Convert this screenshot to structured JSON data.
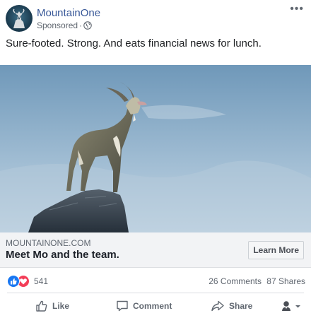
{
  "header": {
    "page_name": "MountainOne",
    "sponsored": "Sponsored",
    "separator": "·",
    "more_label": "•••"
  },
  "post": {
    "text": "Sure-footed. Strong. And eats financial news for lunch."
  },
  "link": {
    "domain": "MOUNTAINONE.COM",
    "headline": "Meet Mo and the team.",
    "cta": "Learn More"
  },
  "reactions": {
    "count": "541",
    "comments": "26 Comments",
    "shares": "87 Shares"
  },
  "actions": {
    "like": "Like",
    "comment": "Comment",
    "share": "Share"
  },
  "icons": {
    "globe": "globe-icon",
    "like_reaction": "like-reaction-icon",
    "love_reaction": "love-reaction-icon",
    "like": "thumbs-up-icon",
    "comment": "comment-bubble-icon",
    "share": "share-arrow-icon",
    "audience": "audience-selector-icon"
  },
  "colors": {
    "page_name": "#385898",
    "like_blue": "#1877f2",
    "love_red": "#f33e58",
    "link_box_bg": "#f2f3f5"
  }
}
